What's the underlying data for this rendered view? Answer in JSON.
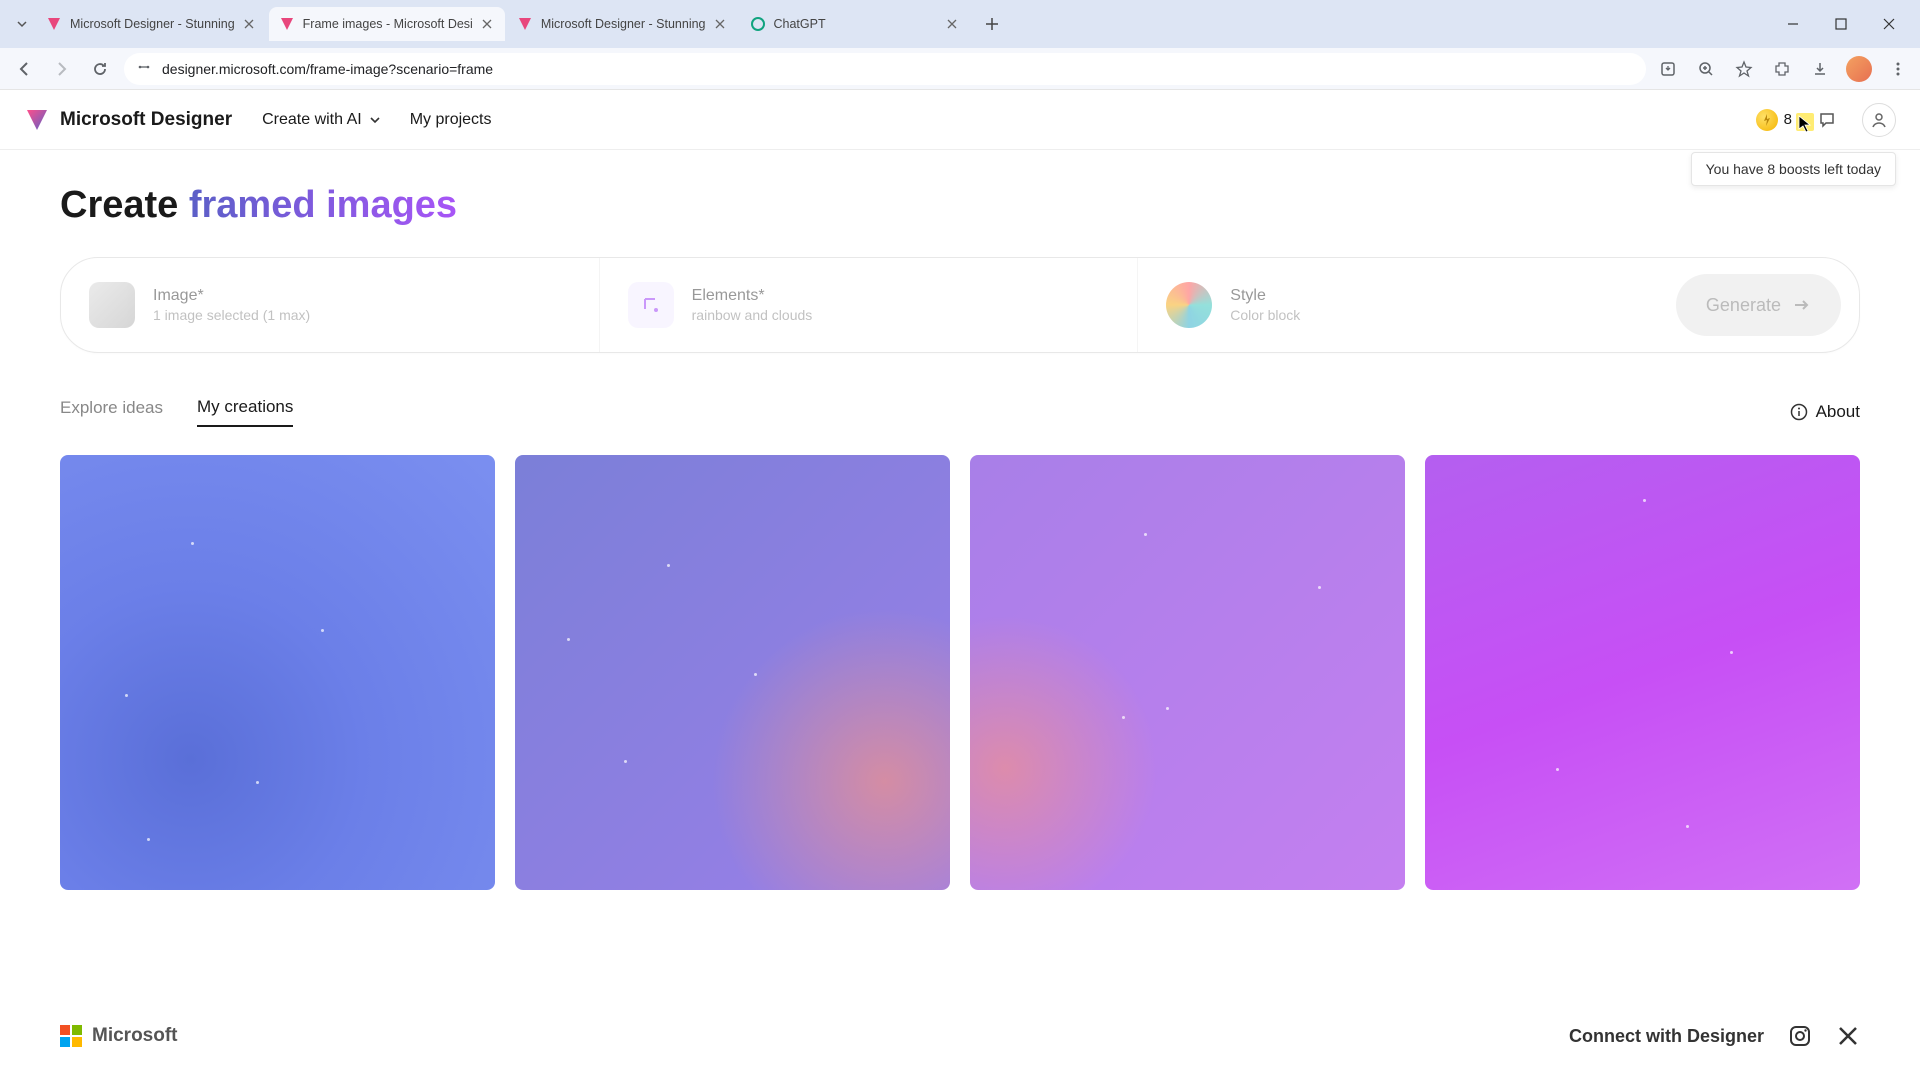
{
  "browser": {
    "tabs": [
      {
        "title": "Microsoft Designer - Stunning",
        "favicon": "designer"
      },
      {
        "title": "Frame images - Microsoft Desi",
        "favicon": "designer",
        "active": true
      },
      {
        "title": "Microsoft Designer - Stunning",
        "favicon": "designer"
      },
      {
        "title": "ChatGPT",
        "favicon": "chatgpt"
      }
    ],
    "url": "designer.microsoft.com/frame-image?scenario=frame"
  },
  "header": {
    "app_name": "Microsoft Designer",
    "nav": {
      "create": "Create with AI",
      "projects": "My projects"
    },
    "boost_count": "8",
    "tooltip": "You have 8 boosts left today"
  },
  "page": {
    "title_plain": "Create ",
    "title_accent": "framed images",
    "inputs": {
      "image": {
        "title": "Image*",
        "sub": "1 image selected (1 max)"
      },
      "elements": {
        "title": "Elements*",
        "sub": "rainbow and clouds"
      },
      "style": {
        "title": "Style",
        "sub": "Color block"
      }
    },
    "generate_label": "Generate",
    "tabs": {
      "explore": "Explore ideas",
      "mine": "My creations"
    },
    "about": "About"
  },
  "footer": {
    "ms": "Microsoft",
    "connect": "Connect with Designer"
  }
}
